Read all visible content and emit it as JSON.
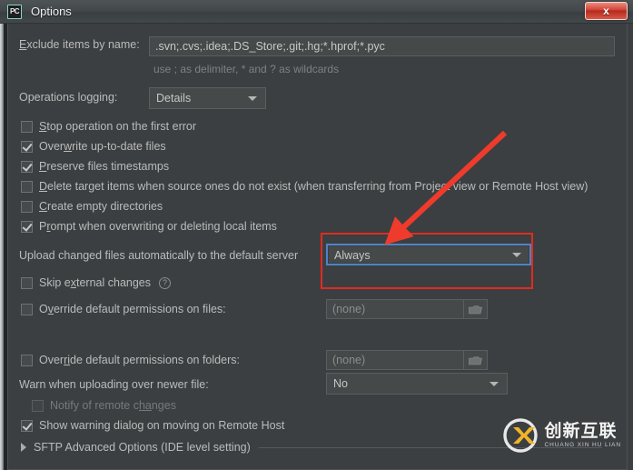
{
  "window": {
    "title": "Options",
    "app_icon": "pycharm-icon",
    "icon_text": "PC",
    "close_label": "x"
  },
  "colors": {
    "background": "#3c3f41",
    "panel_border": "#4d5254",
    "text": "#bbbbbb",
    "muted_text": "#7e8183",
    "field_bg": "#45494a",
    "field_border": "#5a5e60",
    "focus_blue": "#4e84c4",
    "annotation_red": "#e02b20",
    "close_red": "#b52a1c"
  },
  "form": {
    "exclude": {
      "label": "Exclude items by name:",
      "label_accel": "E",
      "value": ".svn;.cvs;.idea;.DS_Store;.git;.hg;*.hprof;*.pyc",
      "hint": "use ; as delimiter, * and ? as wildcards"
    },
    "operations_logging": {
      "label": "Operations logging:",
      "value": "Details"
    },
    "checkboxes": [
      {
        "id": "stop-operation-on-first-error",
        "label": "Stop operation on the first error",
        "accel": "S",
        "checked": false,
        "disabled": false
      },
      {
        "id": "overwrite-up-to-date-files",
        "label": "Overwrite up-to-date files",
        "accel": "w",
        "checked": true,
        "disabled": false
      },
      {
        "id": "preserve-files-timestamps",
        "label": "Preserve files timestamps",
        "accel": "P",
        "checked": true,
        "disabled": false
      },
      {
        "id": "delete-target-items",
        "label": "Delete target items when source ones do not exist (when transferring from Project view or Remote Host view)",
        "accel": "D",
        "checked": false,
        "disabled": false
      },
      {
        "id": "create-empty-directories",
        "label": "Create empty directories",
        "accel": "C",
        "checked": false,
        "disabled": false
      },
      {
        "id": "prompt-when-overwriting",
        "label": "Prompt when overwriting or deleting local items",
        "accel": "r",
        "checked": true,
        "disabled": false
      }
    ],
    "upload_changed": {
      "label": "Upload changed files automatically to the default server",
      "value": "Always"
    },
    "skip_external": {
      "label": "Skip external changes",
      "accel": "x",
      "checked": false,
      "help_icon": "question-mark-icon",
      "help_glyph": "?"
    },
    "override_files": {
      "label": "Override default permissions on files:",
      "accel": "v",
      "checked": false,
      "value": "(none)",
      "browse_icon": "folder-icon"
    },
    "override_folders": {
      "label": "Override default permissions on folders:",
      "accel": "ri",
      "checked": false,
      "value": "(none)",
      "browse_icon": "folder-icon"
    },
    "warn_newer": {
      "label": "Warn when uploading over newer file:",
      "value": "No"
    },
    "notify_remote": {
      "label": "Notify of remote changes",
      "accel": "ha",
      "checked": false,
      "disabled": true
    },
    "show_warning_dialog": {
      "label": "Show warning dialog on moving on Remote Host",
      "checked": true,
      "disabled": false
    },
    "sftp_section": {
      "label": "SFTP Advanced Options (IDE level setting)",
      "expanded": false,
      "icon": "chevron-right-icon"
    }
  },
  "annotations": {
    "highlight_rect": "red-rectangle-around-upload-dropdown",
    "arrow": "red-arrow-pointing-to-dropdown"
  },
  "watermark": {
    "logo": "chuangxinhulian-logo",
    "chinese": "创新互联",
    "pinyin": "CHUANG XIN HU LIAN"
  }
}
